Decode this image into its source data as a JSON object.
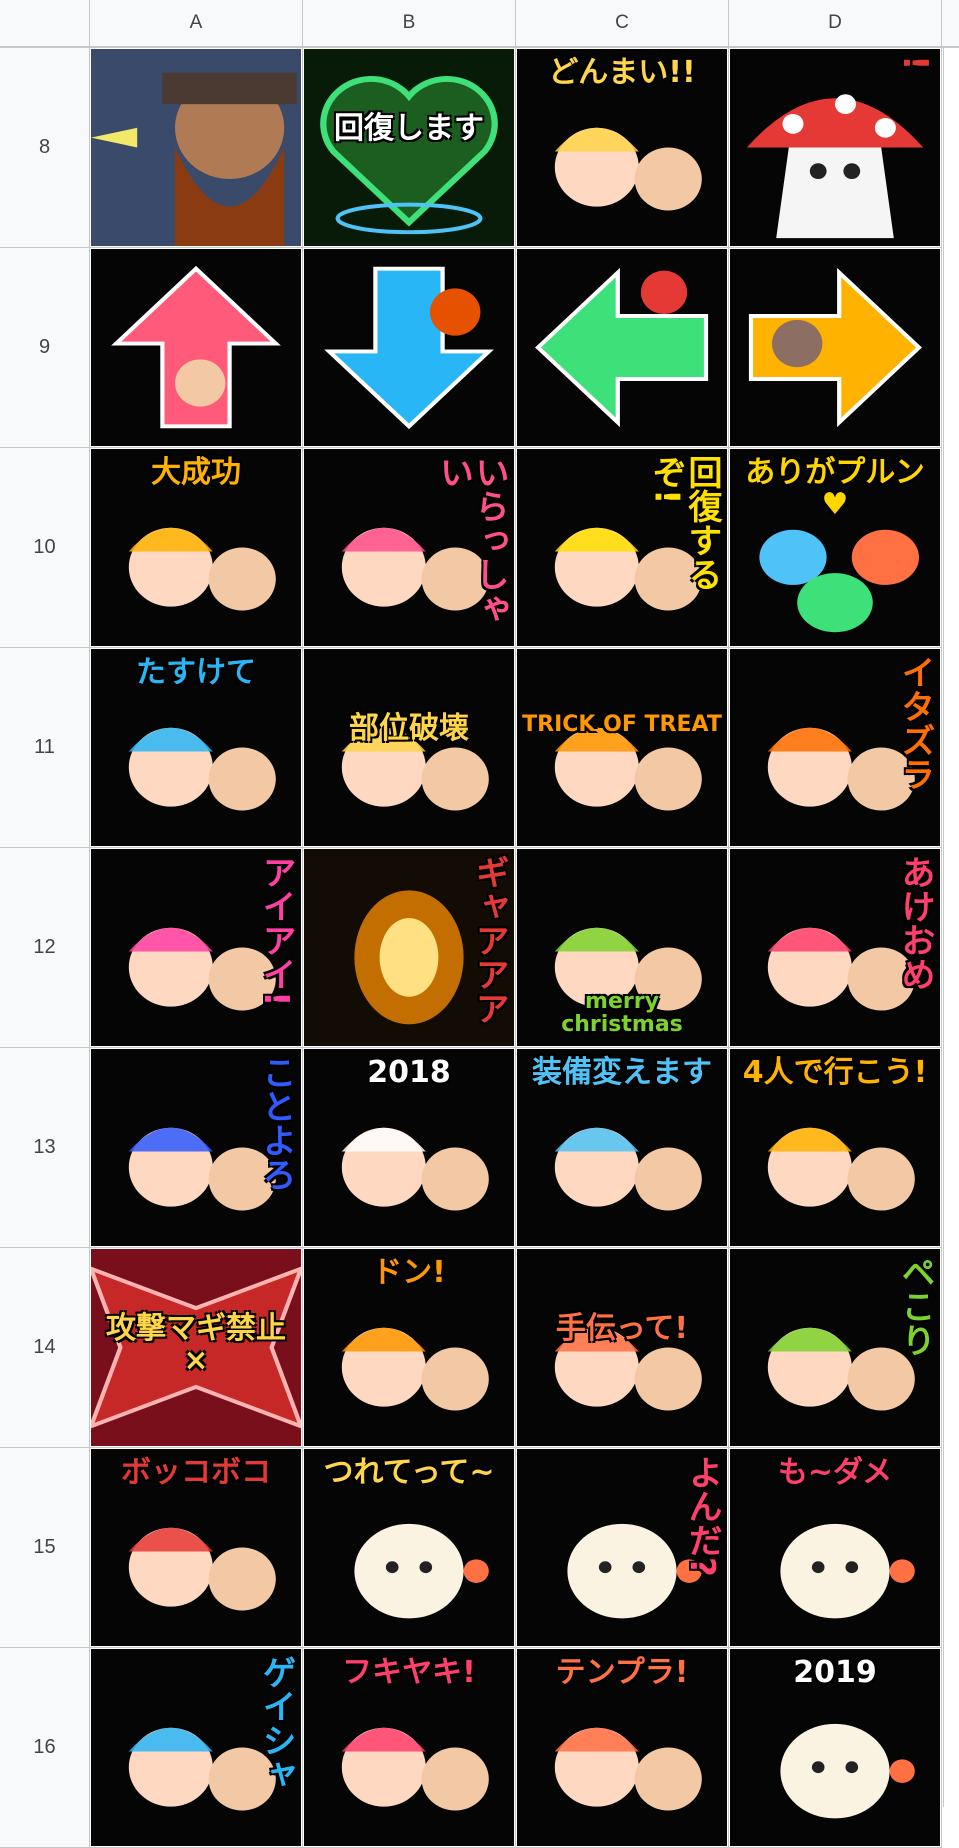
{
  "columns": [
    "A",
    "B",
    "C",
    "D"
  ],
  "rows": [
    {
      "number": "8",
      "cells": [
        {
          "text": "",
          "style": "vert",
          "color": "#f2c94c",
          "bg": "#3a2b20",
          "art": "dwarf"
        },
        {
          "text": "回復します",
          "style": "mid",
          "color": "#ffffff",
          "bg": "#081a08",
          "art": "heart"
        },
        {
          "text": "どんまい!!",
          "style": "top",
          "color": "#ffd54a",
          "bg": "#050505",
          "art": "chars"
        },
        {
          "text": "!",
          "style": "vert",
          "color": "#e53935",
          "bg": "#050505",
          "art": "mushroom"
        }
      ]
    },
    {
      "number": "9",
      "cells": [
        {
          "text": "",
          "style": "top",
          "color": "#ffffff",
          "bg": "#050505",
          "art": "arrow-up"
        },
        {
          "text": "",
          "style": "top",
          "color": "#ffffff",
          "bg": "#050505",
          "art": "arrow-down"
        },
        {
          "text": "",
          "style": "top",
          "color": "#ffffff",
          "bg": "#050505",
          "art": "arrow-left"
        },
        {
          "text": "",
          "style": "top",
          "color": "#ffffff",
          "bg": "#050505",
          "art": "arrow-right"
        }
      ]
    },
    {
      "number": "10",
      "cells": [
        {
          "text": "大成功",
          "style": "top",
          "color": "#ffb300",
          "bg": "#050505",
          "art": "chars"
        },
        {
          "text": "いらっしゃい",
          "style": "vert",
          "color": "#ff4f8b",
          "bg": "#050505",
          "art": "chars"
        },
        {
          "text": "回復するぞ!",
          "style": "vert",
          "color": "#ffe000",
          "bg": "#050505",
          "art": "chars"
        },
        {
          "text": "ありがプルン♥",
          "style": "top",
          "color": "#ffd600",
          "bg": "#050505",
          "art": "slimes"
        }
      ]
    },
    {
      "number": "11",
      "cells": [
        {
          "text": "たすけて",
          "style": "top",
          "color": "#29b6f6",
          "bg": "#050505",
          "art": "chars"
        },
        {
          "text": "部位破壊",
          "style": "mid",
          "color": "#ffd54a",
          "bg": "#050505",
          "art": "chars"
        },
        {
          "text": "TRICK OF TREAT",
          "style": "mid",
          "color": "#ff9800",
          "bg": "#050505",
          "art": "chars"
        },
        {
          "text": "イタズラ",
          "style": "vert",
          "color": "#ff6f00",
          "bg": "#050505",
          "art": "chars"
        }
      ]
    },
    {
      "number": "12",
      "cells": [
        {
          "text": "アイアイ!",
          "style": "vert",
          "color": "#ff3fa4",
          "bg": "#050505",
          "art": "chars"
        },
        {
          "text": "ギャアアア",
          "style": "vert",
          "color": "#e53935",
          "bg": "#120c05",
          "art": "fire"
        },
        {
          "text": "merry christmas",
          "style": "bottom",
          "color": "#7cd32e",
          "bg": "#050505",
          "art": "chars"
        },
        {
          "text": "あけおめ",
          "style": "vert",
          "color": "#ff3f6c",
          "bg": "#050505",
          "art": "chars"
        }
      ]
    },
    {
      "number": "13",
      "cells": [
        {
          "text": "ことよろ",
          "style": "vert",
          "color": "#2f5bff",
          "bg": "#050505",
          "art": "chars"
        },
        {
          "text": "2018",
          "style": "top",
          "color": "#ffffff",
          "bg": "#050505",
          "art": "chars"
        },
        {
          "text": "装備変えます",
          "style": "top",
          "color": "#4fc3f7",
          "bg": "#050505",
          "art": "chars"
        },
        {
          "text": "4人で行こう!",
          "style": "top",
          "color": "#ffb300",
          "bg": "#050505",
          "art": "chars"
        }
      ]
    },
    {
      "number": "14",
      "cells": [
        {
          "text": "攻撃マギ禁止×",
          "style": "mid",
          "color": "#ffd54a",
          "bg": "#7a0f1c",
          "art": "banner"
        },
        {
          "text": "ドン!",
          "style": "top",
          "color": "#ff9800",
          "bg": "#050505",
          "art": "chars"
        },
        {
          "text": "手伝って!",
          "style": "mid",
          "color": "#ff7043",
          "bg": "#050505",
          "art": "chars"
        },
        {
          "text": "ペこり",
          "style": "vert",
          "color": "#7cd32e",
          "bg": "#050505",
          "art": "chars"
        }
      ]
    },
    {
      "number": "15",
      "cells": [
        {
          "text": "ボッコボコ",
          "style": "top",
          "color": "#e53935",
          "bg": "#050505",
          "art": "chars"
        },
        {
          "text": "つれてって~",
          "style": "top",
          "color": "#ffd54a",
          "bg": "#050505",
          "art": "sheep"
        },
        {
          "text": "よんだ?",
          "style": "vert",
          "color": "#ff3f6c",
          "bg": "#050505",
          "art": "sheep"
        },
        {
          "text": "も~ダメ",
          "style": "top",
          "color": "#ff3f6c",
          "bg": "#050505",
          "art": "sheep"
        }
      ]
    },
    {
      "number": "16",
      "cells": [
        {
          "text": "ゲイシャ",
          "style": "vert",
          "color": "#29b6f6",
          "bg": "#050505",
          "art": "chars"
        },
        {
          "text": "フキヤキ!",
          "style": "top",
          "color": "#ff3f6c",
          "bg": "#050505",
          "art": "chars"
        },
        {
          "text": "テンプラ!",
          "style": "top",
          "color": "#ff7043",
          "bg": "#050505",
          "art": "chars"
        },
        {
          "text": "2019",
          "style": "top",
          "color": "#ffffff",
          "bg": "#050505",
          "art": "sheep"
        }
      ]
    }
  ]
}
